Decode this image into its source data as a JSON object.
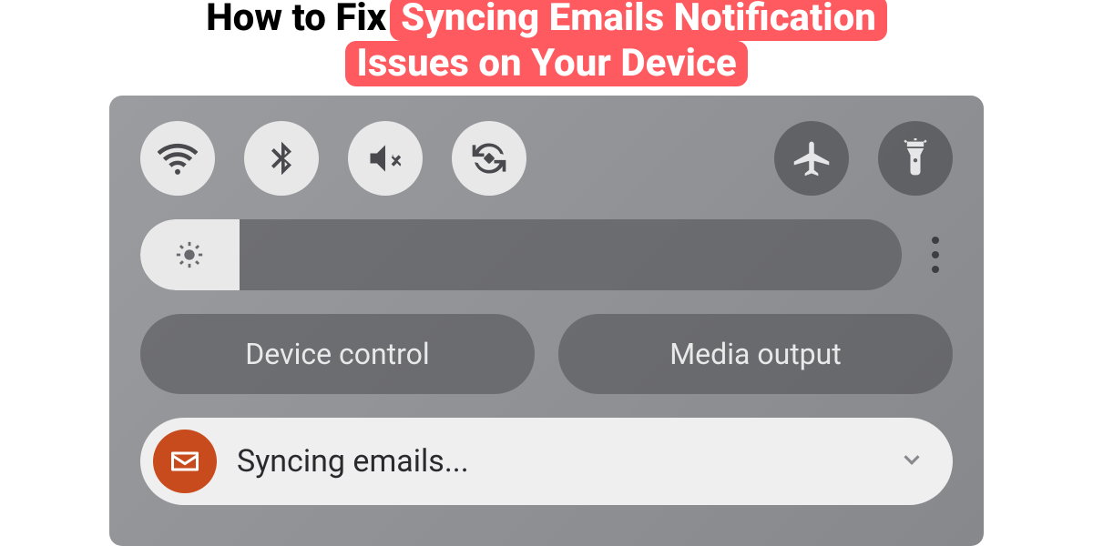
{
  "title": {
    "prefix": "How to Fix",
    "highlight_line1": "Syncing Emails Notification",
    "highlight_line2": "Issues on Your Device"
  },
  "quick_settings": {
    "toggles": [
      {
        "name": "wifi",
        "active": true
      },
      {
        "name": "bluetooth",
        "active": true
      },
      {
        "name": "mute",
        "active": true
      },
      {
        "name": "rotate",
        "active": true
      },
      {
        "name": "airplane",
        "active": false
      },
      {
        "name": "flashlight",
        "active": false
      }
    ],
    "brightness_percent": 13
  },
  "pills": {
    "device_control": "Device control",
    "media_output": "Media output"
  },
  "notification": {
    "app": "mail",
    "text": "Syncing emails..."
  },
  "colors": {
    "accent": "#ff5a5f",
    "mail_icon_bg": "#c84b1e",
    "panel_bg": "#8f9195"
  }
}
